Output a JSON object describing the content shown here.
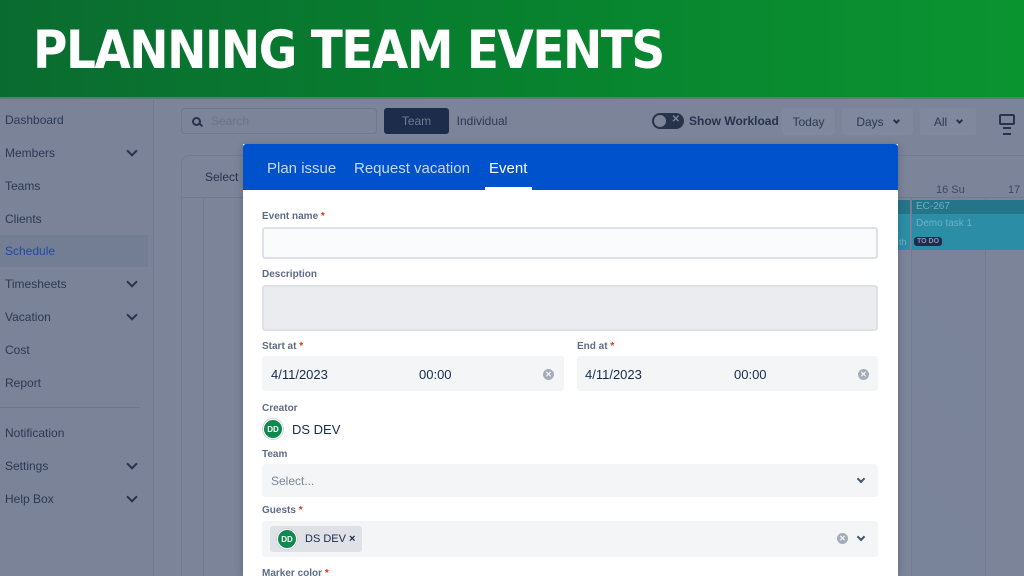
{
  "banner": {
    "title": "PLANNING TEAM EVENTS",
    "gradient_start": "#0a6b30",
    "gradient_end": "#0a9430"
  },
  "sidebar": {
    "items": [
      {
        "label": "Dashboard",
        "has_chevron": false,
        "active": false
      },
      {
        "label": "Members",
        "has_chevron": true,
        "active": false
      },
      {
        "label": "Teams",
        "has_chevron": false,
        "active": false
      },
      {
        "label": "Clients",
        "has_chevron": false,
        "active": false
      },
      {
        "label": "Schedule",
        "has_chevron": false,
        "active": true
      },
      {
        "label": "Timesheets",
        "has_chevron": true,
        "active": false
      },
      {
        "label": "Vacation",
        "has_chevron": true,
        "active": false
      },
      {
        "label": "Cost",
        "has_chevron": false,
        "active": false
      },
      {
        "label": "Report",
        "has_chevron": false,
        "active": false
      },
      {
        "label": "Notification",
        "has_chevron": false,
        "active": false
      },
      {
        "label": "Settings",
        "has_chevron": true,
        "active": false
      },
      {
        "label": "Help Box",
        "has_chevron": true,
        "active": false
      }
    ]
  },
  "toolbar": {
    "search_placeholder": "Search",
    "view_toggle": {
      "team": "Team",
      "individual": "Individual",
      "selected": "Team"
    },
    "show_workload_label": "Show Workload",
    "show_workload_on": false,
    "today_label": "Today",
    "range_select": "Days",
    "filter_select": "All"
  },
  "board": {
    "select_label": "Select",
    "day_headers": [
      "16 Su",
      "17"
    ],
    "task": {
      "id": "EC-267",
      "name": "Demo task 1",
      "status": "TO DO",
      "color": "#2b8ea6"
    },
    "prev_task_fragment": "th"
  },
  "modal": {
    "tabs": [
      {
        "label": "Plan issue",
        "active": false
      },
      {
        "label": "Request vacation",
        "active": false
      },
      {
        "label": "Event",
        "active": true
      }
    ],
    "header_color": "#0052cc",
    "fields": {
      "event_name": {
        "label": "Event name",
        "required": "*",
        "value": ""
      },
      "description": {
        "label": "Description",
        "value": ""
      },
      "start_at": {
        "label": "Start at",
        "required": "*",
        "date": "4/11/2023",
        "time": "00:00"
      },
      "end_at": {
        "label": "End at",
        "required": "*",
        "date": "4/11/2023",
        "time": "00:00"
      },
      "creator": {
        "label": "Creator",
        "initials": "DD",
        "name": "DS DEV"
      },
      "team": {
        "label": "Team",
        "placeholder": "Select..."
      },
      "guests": {
        "label": "Guests",
        "required": "*",
        "chips": [
          {
            "initials": "DD",
            "name": "DS DEV"
          }
        ]
      },
      "marker_color": {
        "label": "Marker color",
        "required": "*"
      }
    }
  }
}
